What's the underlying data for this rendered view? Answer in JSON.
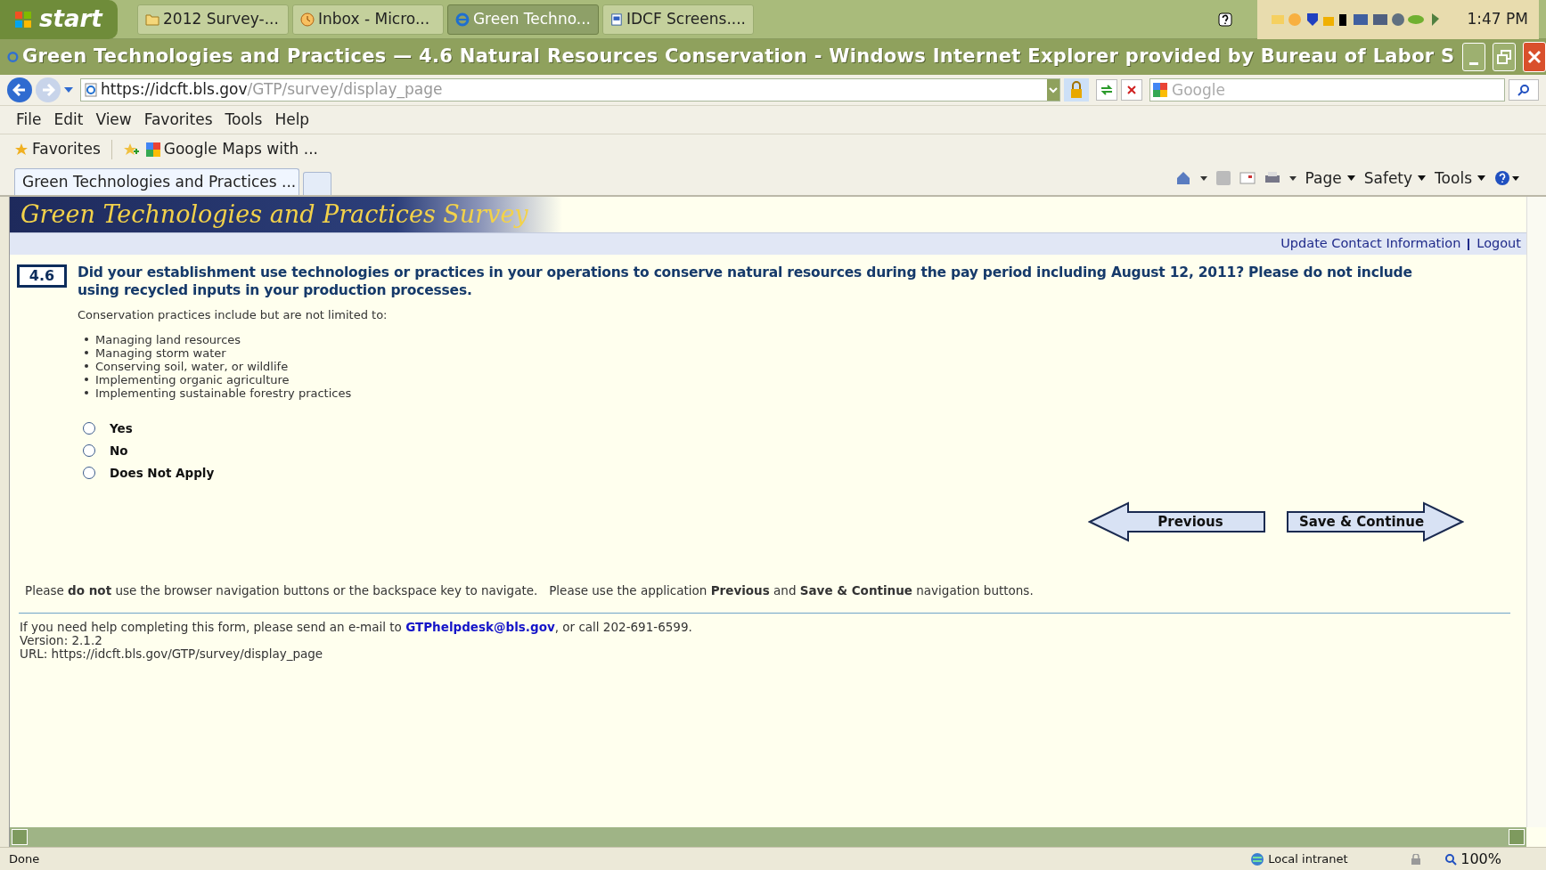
{
  "taskbar": {
    "start_label": "start",
    "tasks": [
      {
        "label": "2012 Survey-...",
        "kind": "folder",
        "selected": false
      },
      {
        "label": "Inbox - Micro...",
        "kind": "mail",
        "selected": false
      },
      {
        "label": "Green Techno...",
        "kind": "browser",
        "selected": true
      },
      {
        "label": "IDCF Screens....",
        "kind": "document",
        "selected": false
      }
    ],
    "clock": "1:47 PM"
  },
  "window": {
    "title": "Green Technologies and Practices — 4.6 Natural Resources Conservation - Windows Internet Explorer provided by Bureau of Labor S"
  },
  "address": {
    "host": "https://idcft.bls.gov",
    "path": "/GTP/survey/display_page",
    "search_placeholder": "Google"
  },
  "menu": [
    "File",
    "Edit",
    "View",
    "Favorites",
    "Tools",
    "Help"
  ],
  "favorites": {
    "label": "Favorites",
    "links": [
      "Google Maps with ..."
    ]
  },
  "browser_tabs": [
    {
      "label": "Green Technologies and Practices ...",
      "selected": true
    }
  ],
  "command_bar": [
    "Page",
    "Safety",
    "Tools"
  ],
  "page": {
    "banner_title": "Green Technologies and Practices Survey",
    "header_links": [
      "Update Contact Information",
      "Logout"
    ],
    "question": {
      "number": "4.6",
      "text": "Did your establishment use technologies or practices in your operations to conserve natural resources during the pay period including August 12, 2011? Please do not include using recycled inputs in your production processes.",
      "intro": "Conservation practices include but are not limited to:",
      "bullets": [
        "Managing land resources",
        "Managing storm water",
        "Conserving soil, water, or wildlife",
        "Implementing organic agriculture",
        "Implementing sustainable forestry practices"
      ],
      "options": [
        {
          "label": "Yes",
          "selected": false
        },
        {
          "label": "No",
          "selected": false
        },
        {
          "label": "Does Not Apply",
          "selected": false
        }
      ]
    },
    "buttons": {
      "previous": "Previous",
      "next": "Save & Continue"
    },
    "notice": "Please **do not** use the browser navigation buttons or the backspace key to navigate.   Please use the application **Previous** and **Save & Continue** navigation buttons.",
    "help": {
      "before": "If you need help completing this form, please send an e-mail to",
      "email": "GTPhelpdesk@bls.gov",
      "after": ", or call 202-691-6599."
    },
    "version": "Version: 2.1.2",
    "url": "URL: https://idcft.bls.gov/GTP/survey/display_page"
  },
  "status": {
    "text": "Done",
    "zone": "Local intranet",
    "zoom": "100%"
  }
}
